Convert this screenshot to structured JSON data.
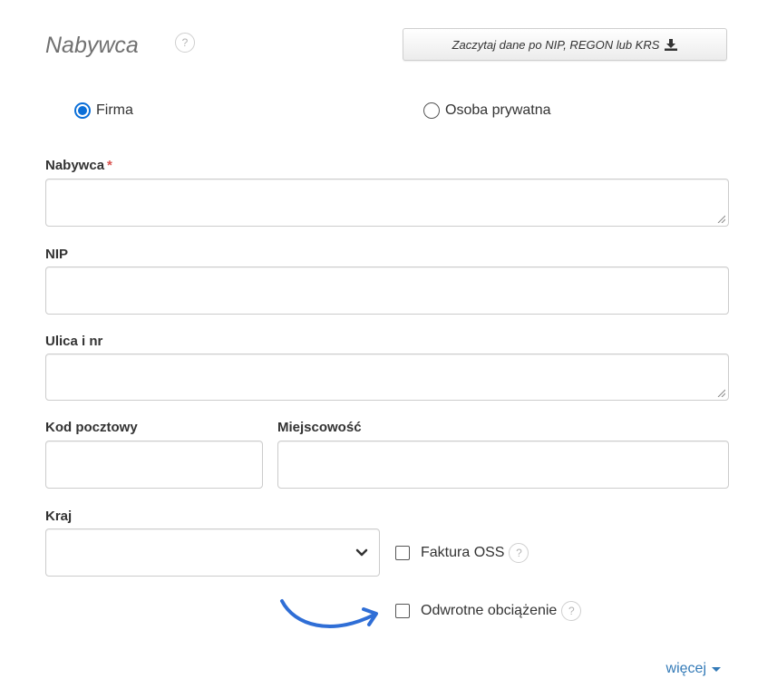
{
  "header": {
    "title": "Nabywca",
    "help_symbol": "?",
    "fetch_button_label": "Zaczytaj dane po NIP, REGON lub KRS"
  },
  "buyer_type": {
    "options": [
      {
        "label": "Firma",
        "checked": true
      },
      {
        "label": "Osoba prywatna",
        "checked": false
      }
    ]
  },
  "fields": {
    "buyer": {
      "label": "Nabywca",
      "required_mark": "*",
      "value": ""
    },
    "nip": {
      "label": "NIP",
      "value": ""
    },
    "street": {
      "label": "Ulica i nr",
      "value": ""
    },
    "postal_code": {
      "label": "Kod pocztowy",
      "value": ""
    },
    "city": {
      "label": "Miejscowość",
      "value": ""
    },
    "country": {
      "label": "Kraj",
      "selected": ""
    }
  },
  "checkboxes": {
    "oss": {
      "label": "Faktura OSS",
      "checked": false
    },
    "reverse_charge": {
      "label": "Odwrotne obciążenie",
      "checked": false
    }
  },
  "more_link": {
    "label": "więcej"
  },
  "colors": {
    "accent": "#0b6fd8",
    "link": "#337ab7",
    "required": "#d9534f",
    "annotation_arrow": "#2f6ed6"
  }
}
